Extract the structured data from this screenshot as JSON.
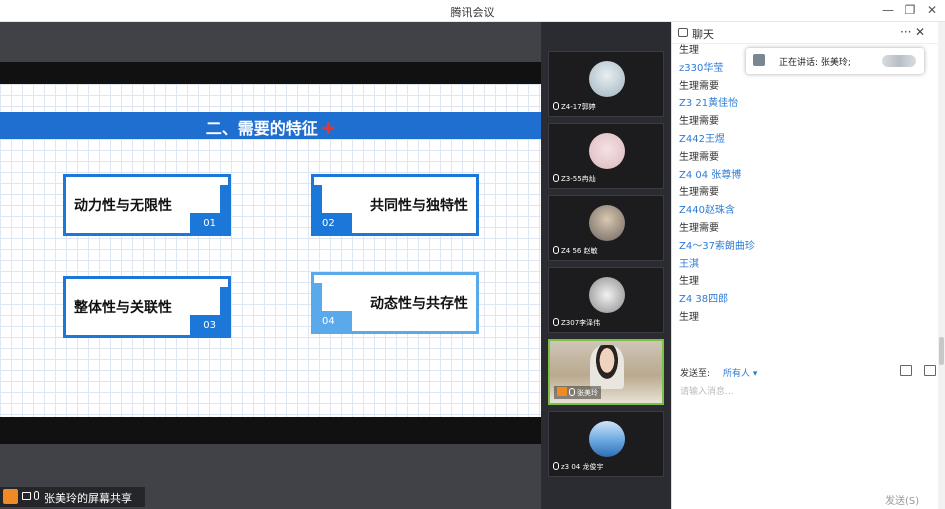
{
  "window": {
    "title": "腾讯会议",
    "controls": {
      "minimize": "—",
      "restore": "❐",
      "close": "✕"
    }
  },
  "slide": {
    "title": "二、需要的特征",
    "title_mark": "✚",
    "cards": [
      {
        "label": "动力性与无限性",
        "num": "01"
      },
      {
        "label": "共同性与独特性",
        "num": "02"
      },
      {
        "label": "整体性与关联性",
        "num": "03"
      },
      {
        "label": "动态性与共存性",
        "num": "04"
      }
    ]
  },
  "videos": [
    {
      "name": "Z4-17郭婷",
      "avatar": "avatar-light-icon"
    },
    {
      "name": "Z3-55冉灿",
      "avatar": "avatar-cat-icon"
    },
    {
      "name": "Z4 56 赵敏",
      "avatar": "avatar-person-icon"
    },
    {
      "name": "Z307李泽伟",
      "avatar": "avatar-gray-icon"
    },
    {
      "name": "张美玲",
      "avatar": "camera-feed"
    },
    {
      "name": "z3  04  龙俊宇",
      "avatar": "avatar-mountain-icon"
    }
  ],
  "chat": {
    "title": "聊天",
    "more": "···",
    "close": "✕",
    "messages": [
      {
        "text": "生理",
        "type": "t"
      },
      {
        "text": "z330华莹",
        "type": "n"
      },
      {
        "text": "生理需要",
        "type": "t"
      },
      {
        "text": "Z3 21黄佳怡",
        "type": "n"
      },
      {
        "text": "生理需要",
        "type": "t"
      },
      {
        "text": "Z442王煜",
        "type": "n"
      },
      {
        "text": "生理需要",
        "type": "t"
      },
      {
        "text": "Z4 04 张尊博",
        "type": "n"
      },
      {
        "text": "生理需要",
        "type": "t"
      },
      {
        "text": "Z440赵珠含",
        "type": "n"
      },
      {
        "text": "生理需要",
        "type": "t"
      },
      {
        "text": "Z4～37索朗曲珍",
        "type": "n"
      },
      {
        "text": "王淇",
        "type": "n"
      },
      {
        "text": "生理",
        "type": "t"
      },
      {
        "text": "Z4  38四郎",
        "type": "n"
      },
      {
        "text": "生理",
        "type": "t"
      }
    ],
    "speaking": "正在讲话: 张美玲;",
    "send_to_label": "发送至:",
    "send_to_value": "所有人 ▾",
    "input_placeholder": "请输入消息...",
    "send_button": "发送(S)"
  },
  "share": {
    "label": "张美玲的屏幕共享"
  }
}
